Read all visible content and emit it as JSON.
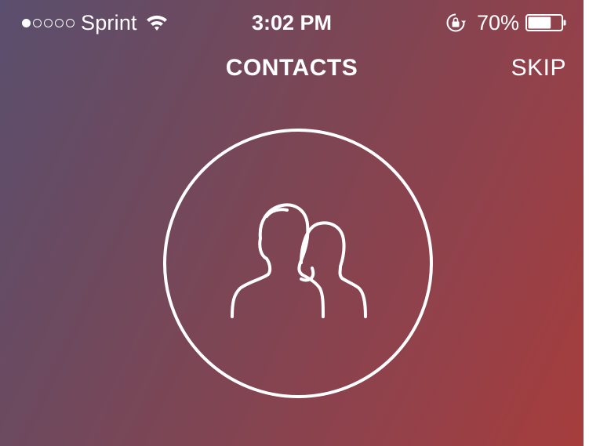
{
  "status_bar": {
    "signal": {
      "filled": 1,
      "total": 5
    },
    "carrier": "Sprint",
    "time": "3:02 PM",
    "battery_percent": "70%",
    "battery_level": 0.7,
    "icons": [
      "wifi-icon",
      "orientation-lock-icon",
      "battery-icon"
    ]
  },
  "nav": {
    "title": "CONTACTS",
    "skip_label": "SKIP"
  },
  "hero": {
    "icon": "contacts-people-icon"
  },
  "colors": {
    "gradient_start": "#5a4f6e",
    "gradient_end": "#a63d3c",
    "foreground": "#ffffff"
  }
}
